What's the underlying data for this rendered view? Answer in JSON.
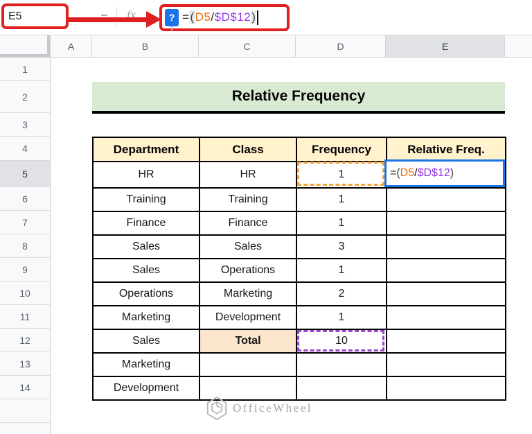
{
  "name_box": {
    "value": "E5"
  },
  "formula_bar": {
    "dash": "–",
    "fx_label": "fx",
    "help_icon": "?"
  },
  "formula": {
    "eq": "=",
    "open": "(",
    "ref1": "D5",
    "op": "/",
    "ref2": "$D$12",
    "close": ")"
  },
  "column_headers": [
    "A",
    "B",
    "C",
    "D",
    "E"
  ],
  "row_headers": [
    "1",
    "2",
    "3",
    "4",
    "5",
    "6",
    "7",
    "8",
    "9",
    "10",
    "11",
    "12",
    "13",
    "14"
  ],
  "selection": {
    "active_cell": "E5",
    "highlighted_row": "5",
    "highlighted_column": "E"
  },
  "sheet": {
    "title": "Relative Frequency"
  },
  "table": {
    "headers": [
      "Department",
      "Class",
      "Frequency",
      "Relative Freq."
    ],
    "rows": [
      {
        "dept": "HR",
        "cls": "HR",
        "freq": "1",
        "rel": ""
      },
      {
        "dept": "Training",
        "cls": "Training",
        "freq": "1",
        "rel": ""
      },
      {
        "dept": "Finance",
        "cls": "Finance",
        "freq": "1",
        "rel": ""
      },
      {
        "dept": "Sales",
        "cls": "Sales",
        "freq": "3",
        "rel": ""
      },
      {
        "dept": "Sales",
        "cls": "Operations",
        "freq": "1",
        "rel": ""
      },
      {
        "dept": "Operations",
        "cls": "Marketing",
        "freq": "2",
        "rel": ""
      },
      {
        "dept": "Marketing",
        "cls": "Development",
        "freq": "1",
        "rel": ""
      },
      {
        "dept": "Sales",
        "cls": "Total",
        "freq": "10",
        "rel": ""
      },
      {
        "dept": "Marketing",
        "cls": "",
        "freq": "",
        "rel": ""
      },
      {
        "dept": "Development",
        "cls": "",
        "freq": "",
        "rel": ""
      }
    ]
  },
  "watermark": {
    "brand": "OfficeWheel"
  },
  "colors": {
    "annotation_red": "#e02020",
    "ref_orange": "#e8710a",
    "ref_purple": "#9334e6",
    "dash_orange": "#f2a33c",
    "dash_purple": "#9b45d1",
    "selection_blue": "#1a73e8",
    "title_green": "#d9ead3",
    "header_tan": "#fff2cc",
    "total_peach": "#fce5cd",
    "table_border": "#000000",
    "watermark_gray": "#a7a9ac"
  }
}
